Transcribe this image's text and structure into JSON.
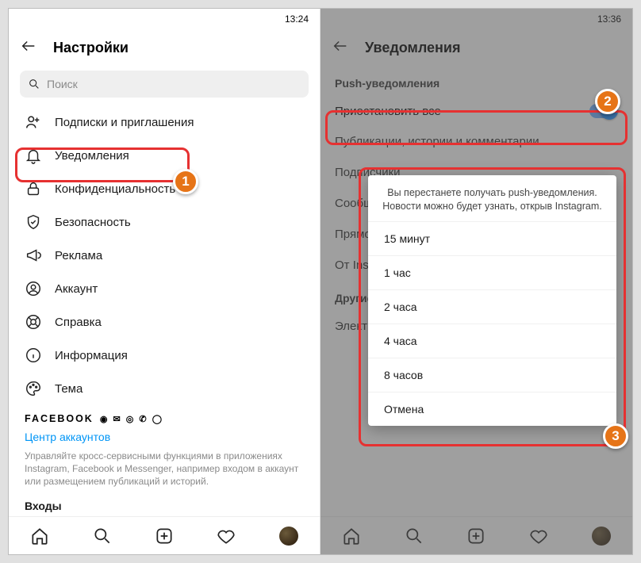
{
  "left": {
    "time": "13:24",
    "title": "Настройки",
    "search_placeholder": "Поиск",
    "menu": [
      "Подписки и приглашения",
      "Уведомления",
      "Конфиденциальность",
      "Безопасность",
      "Реклама",
      "Аккаунт",
      "Справка",
      "Информация",
      "Тема"
    ],
    "facebook_label": "FACEBOOK",
    "accounts_center": "Центр аккаунтов",
    "accounts_desc": "Управляйте кросс-сервисными функциями в приложениях Instagram, Facebook и Messenger, например входом в аккаунт или размещением публикаций и историй.",
    "logins_label": "Входы"
  },
  "right": {
    "time": "13:36",
    "title": "Уведомления",
    "push_section": "Push-уведомления",
    "pause_all": "Приостановить все",
    "rows": [
      "Публикации, истории и комментарии",
      "Подписчики",
      "Сообщения",
      "Прямой эфир",
      "От Instagram"
    ],
    "other_section": "Другие уведомления",
    "other_row": "Электронная почта",
    "dialog": {
      "message": "Вы перестанете получать push-уведомления. Новости можно будет узнать, открыв Instagram.",
      "options": [
        "15 минут",
        "1 час",
        "2 часа",
        "4 часа",
        "8 часов",
        "Отмена"
      ]
    }
  },
  "callouts": {
    "c1": "1",
    "c2": "2",
    "c3": "3"
  }
}
